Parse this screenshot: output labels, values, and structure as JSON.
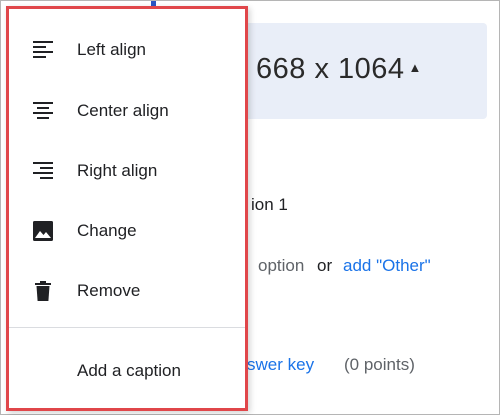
{
  "background": {
    "image_size": "668 x 1064",
    "image_size_caret": "▲",
    "option_label": "ion 1",
    "add_option_text": "option",
    "or_text": "or",
    "add_other_link": "add \"Other\"",
    "answer_key_link": "swer key",
    "points_text": "(0 points)"
  },
  "menu": {
    "items": [
      {
        "label": "Left align",
        "icon": "format-align-left-icon"
      },
      {
        "label": "Center align",
        "icon": "format-align-center-icon"
      },
      {
        "label": "Right align",
        "icon": "format-align-right-icon"
      },
      {
        "label": "Change",
        "icon": "image-icon"
      },
      {
        "label": "Remove",
        "icon": "trash-icon"
      }
    ],
    "caption_label": "Add a caption"
  },
  "colors": {
    "highlight_border": "#e0464a",
    "link": "#1a73e8",
    "header_bg": "#e9eef8"
  }
}
